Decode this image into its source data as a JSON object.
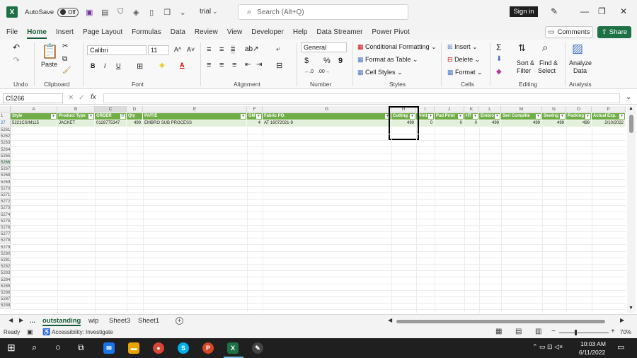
{
  "titlebar": {
    "autosave": "AutoSave",
    "autosave_state": "Off",
    "filename": "trial",
    "search_placeholder": "Search (Alt+Q)",
    "signin": "Sign in"
  },
  "menu": {
    "tabs": [
      "File",
      "Home",
      "Insert",
      "Page Layout",
      "Formulas",
      "Data",
      "Review",
      "View",
      "Developer",
      "Help",
      "Data Streamer",
      "Power Pivot"
    ],
    "active": "Home",
    "comments": "Comments",
    "share": "Share"
  },
  "ribbon": {
    "undo_label": "Undo",
    "clipboard": {
      "paste": "Paste",
      "label": "Clipboard"
    },
    "font": {
      "name": "Calibri",
      "size": "11",
      "bold": "B",
      "italic": "I",
      "underline": "U",
      "grow": "A^",
      "shrink": "A˅",
      "label": "Font"
    },
    "alignment": {
      "label": "Alignment"
    },
    "number": {
      "format": "General",
      "currency": "$",
      "percent": "%",
      "comma": "9",
      "label": "Number"
    },
    "styles": {
      "conditional": "Conditional Formatting",
      "format_table": "Format as Table",
      "cell_styles": "Cell Styles",
      "label": "Styles"
    },
    "cells": {
      "insert": "Insert",
      "delete": "Delete",
      "format": "Format",
      "label": "Cells"
    },
    "editing": {
      "sort": "Sort &",
      "sort2": "Filter",
      "find": "Find &",
      "find2": "Select",
      "label": "Editing"
    },
    "analysis": {
      "analyze": "Analyze",
      "analyze2": "Data",
      "label": "Analysis"
    }
  },
  "formula_bar": {
    "name_box": "C5266",
    "fx": "fx",
    "value": ""
  },
  "grid": {
    "columns": [
      "A",
      "B",
      "C",
      "D",
      "E",
      "F",
      "G",
      "H",
      "I",
      "J",
      "K",
      "L",
      "M",
      "N",
      "O",
      "P"
    ],
    "header_row_num": "1",
    "headers": [
      "Style",
      "Product Type",
      "ORDER",
      "Qty",
      "P/I/T/E",
      "GM",
      "Fabric PO.",
      "Cutting",
      "Print",
      "Pad Print",
      "HT",
      "Embro",
      "Seri Complite",
      "Sewing",
      "Packing",
      "Actual Exp."
    ],
    "data_row_num": "27",
    "data_row": [
      "5221CSIM115",
      "JACKET",
      "0128775347",
      "499",
      "EMBRO SUB PROCESS",
      "4",
      "AT 16072021-9",
      "499",
      "",
      "0",
      "0",
      "0",
      "499",
      "499",
      "499",
      "499",
      "2/10/2022"
    ],
    "row_numbers": [
      "5261",
      "5262",
      "5263",
      "5264",
      "5265",
      "5266",
      "5267",
      "5268",
      "5269",
      "5270",
      "5271",
      "5272",
      "5273",
      "5274",
      "5275",
      "5276",
      "5277",
      "5278",
      "5279",
      "5280",
      "5281",
      "5282",
      "5283",
      "5284",
      "5285",
      "5286",
      "5287",
      "5288"
    ],
    "selected_row": "5266"
  },
  "sheets": {
    "ellipsis": "...",
    "tabs": [
      "outstanding",
      "wip",
      "Sheet3",
      "Sheet1"
    ],
    "active": "outstanding",
    "add": "+"
  },
  "status": {
    "ready": "Ready",
    "accessibility": "Accessibility: Investigate",
    "zoom": "70%"
  },
  "taskbar": {
    "time": "10:03 AM",
    "date": "6/11/2022"
  }
}
